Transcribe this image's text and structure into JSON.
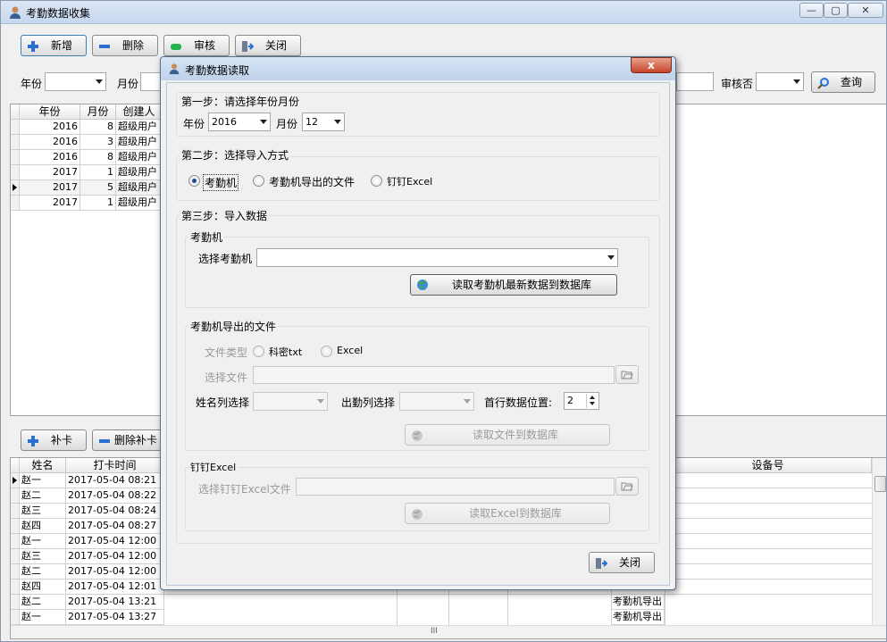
{
  "window": {
    "title": "考勤数据收集"
  },
  "toolbar": {
    "add": "新增",
    "delete": "删除",
    "audit": "审核",
    "close": "关闭"
  },
  "filter": {
    "year_label": "年份",
    "month_label": "月份",
    "audit_label": "审核否",
    "query": "查询"
  },
  "top_grid": {
    "headers": [
      "年份",
      "月份",
      "创建人"
    ],
    "rows": [
      [
        "2016",
        "8",
        "超级用户"
      ],
      [
        "2016",
        "3",
        "超级用户"
      ],
      [
        "2016",
        "8",
        "超级用户"
      ],
      [
        "2017",
        "1",
        "超级用户"
      ],
      [
        "2017",
        "5",
        "超级用户"
      ],
      [
        "2017",
        "1",
        "超级用户"
      ]
    ]
  },
  "bottom_toolbar": {
    "repair": "补卡",
    "delete_repair": "删除补卡"
  },
  "bottom_grid": {
    "headers": [
      "姓名",
      "打卡时间",
      "设备号"
    ],
    "rows": [
      [
        "赵一",
        "2017-05-04 08:21",
        ""
      ],
      [
        "赵二",
        "2017-05-04 08:22",
        ""
      ],
      [
        "赵三",
        "2017-05-04 08:24",
        ""
      ],
      [
        "赵四",
        "2017-05-04 08:27",
        ""
      ],
      [
        "赵一",
        "2017-05-04 12:00",
        ""
      ],
      [
        "赵三",
        "2017-05-04 12:00",
        ""
      ],
      [
        "赵二",
        "2017-05-04 12:00",
        ""
      ],
      [
        "赵四",
        "2017-05-04 12:01",
        ""
      ],
      [
        "赵二",
        "2017-05-04 13:21",
        "考勤机导出"
      ],
      [
        "赵一",
        "2017-05-04 13:27",
        "考勤机导出"
      ]
    ],
    "hscroll_grip": "III"
  },
  "dialog": {
    "title": "考勤数据读取",
    "close_x": "x",
    "step1": {
      "title": "第一步：请选择年份月份",
      "year_label": "年份",
      "year_value": "2016",
      "month_label": "月份",
      "month_value": "12"
    },
    "step2": {
      "title": "第二步：选择导入方式",
      "options": [
        "考勤机",
        "考勤机导出的文件",
        "钉钉Excel"
      ],
      "selected": 0
    },
    "step3": {
      "title": "第三步：导入数据",
      "machine": {
        "title": "考勤机",
        "select_label": "选择考勤机",
        "read_button": "读取考勤机最新数据到数据库"
      },
      "file": {
        "title": "考勤机导出的文件",
        "type_label": "文件类型",
        "type_options": [
          "科密txt",
          "Excel"
        ],
        "choose_label": "选择文件",
        "name_col_label": "姓名列选择",
        "attend_col_label": "出勤列选择",
        "first_row_label": "首行数据位置:",
        "first_row_value": "2",
        "read_button": "读取文件到数据库"
      },
      "dingding": {
        "title": "钉钉Excel",
        "choose_label": "选择钉钉Excel文件",
        "read_button": "读取Excel到数据库"
      }
    },
    "close_button": "关闭"
  },
  "colors": {
    "accent": "#1f4e8d",
    "plus": "#2a6fd1",
    "audit_green": "#22b34a"
  }
}
